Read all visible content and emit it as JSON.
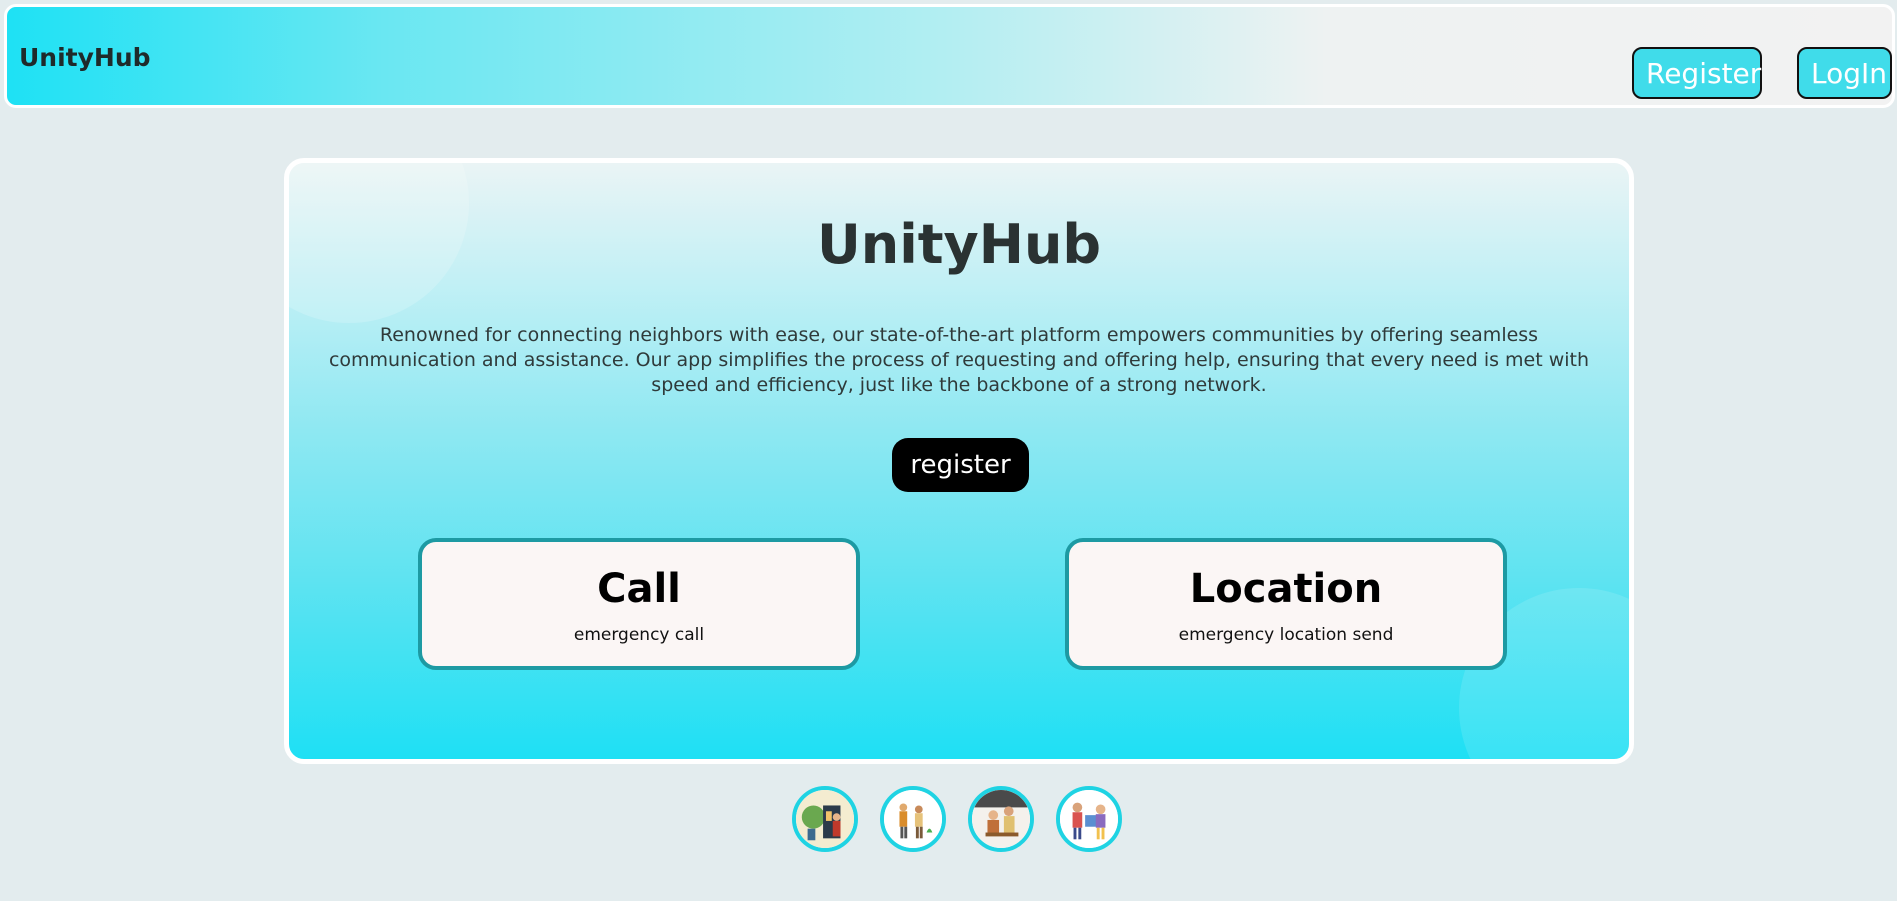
{
  "header": {
    "brand": "UnityHub",
    "register_label": "Register",
    "login_label": "LogIn"
  },
  "hero": {
    "title": "UnityHub",
    "description": "Renowned for connecting neighbors with ease, our state-of-the-art platform empowers communities by offering seamless communication and assistance. Our app simplifies the process of requesting and offering help, ensuring that every need is met with speed and efficiency, just like the backbone of a strong network.",
    "register_label": "register"
  },
  "cards": [
    {
      "title": "Call",
      "subtitle": "emergency call"
    },
    {
      "title": "Location",
      "subtitle": "emergency location send"
    }
  ],
  "thumbnails": [
    {
      "icon": "community-illustration-1-icon"
    },
    {
      "icon": "community-illustration-2-icon"
    },
    {
      "icon": "community-illustration-3-icon"
    },
    {
      "icon": "community-illustration-4-icon"
    }
  ],
  "colors": {
    "accent": "#1ee0f4",
    "nav_button": "#40dcea",
    "card_border": "#1d9aa3"
  }
}
